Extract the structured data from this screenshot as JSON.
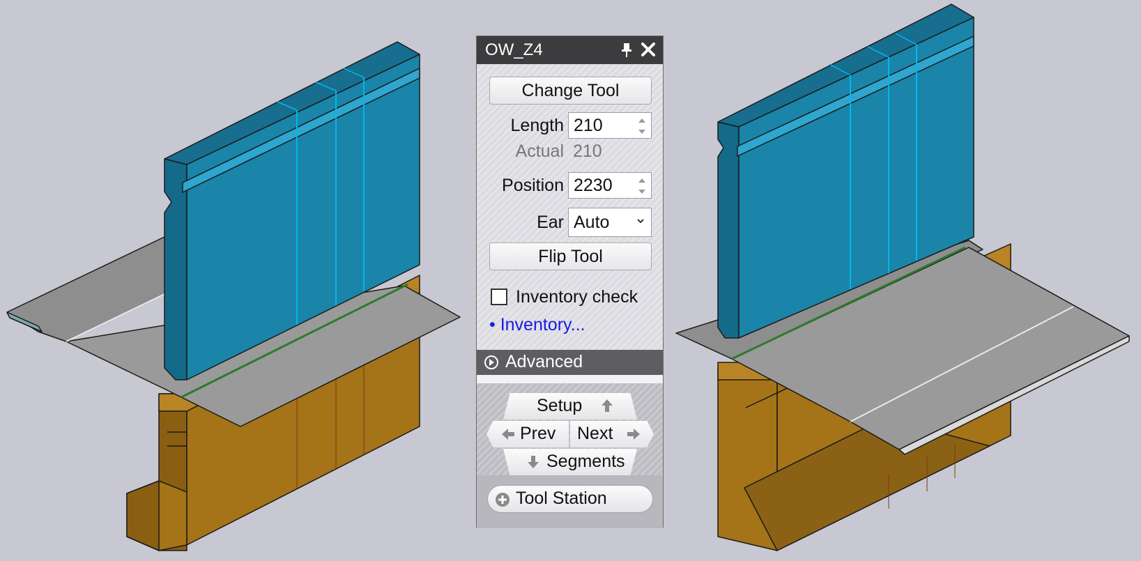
{
  "panel": {
    "title": "OW_Z4",
    "change_tool": "Change Tool",
    "length_label": "Length",
    "length_value": "210",
    "actual_label": "Actual",
    "actual_value": "210",
    "position_label": "Position",
    "position_value": "2230",
    "ear_label": "Ear",
    "ear_value": "Auto",
    "flip_tool": "Flip Tool",
    "inventory_check_label": "Inventory check",
    "inventory_check_checked": false,
    "inventory_link": "• Inventory...",
    "advanced_label": "Advanced",
    "nav": {
      "setup": "Setup",
      "prev": "Prev",
      "next": "Next",
      "segments": "Segments"
    },
    "tool_station": "Tool Station"
  },
  "icons": {
    "pin": "pin-icon",
    "close": "close-icon",
    "advanced": "expand-circle-icon",
    "station": "plus-circle-icon"
  },
  "colors": {
    "punch_blue": "#1a85a8",
    "punch_top": "#176e8e",
    "punch_edge": "#00b7ee",
    "die_orange": "#a57318",
    "sheet_gray": "#8e8e8e",
    "panel_title": "#3c3c3e",
    "link_blue": "#1a1ae0"
  }
}
